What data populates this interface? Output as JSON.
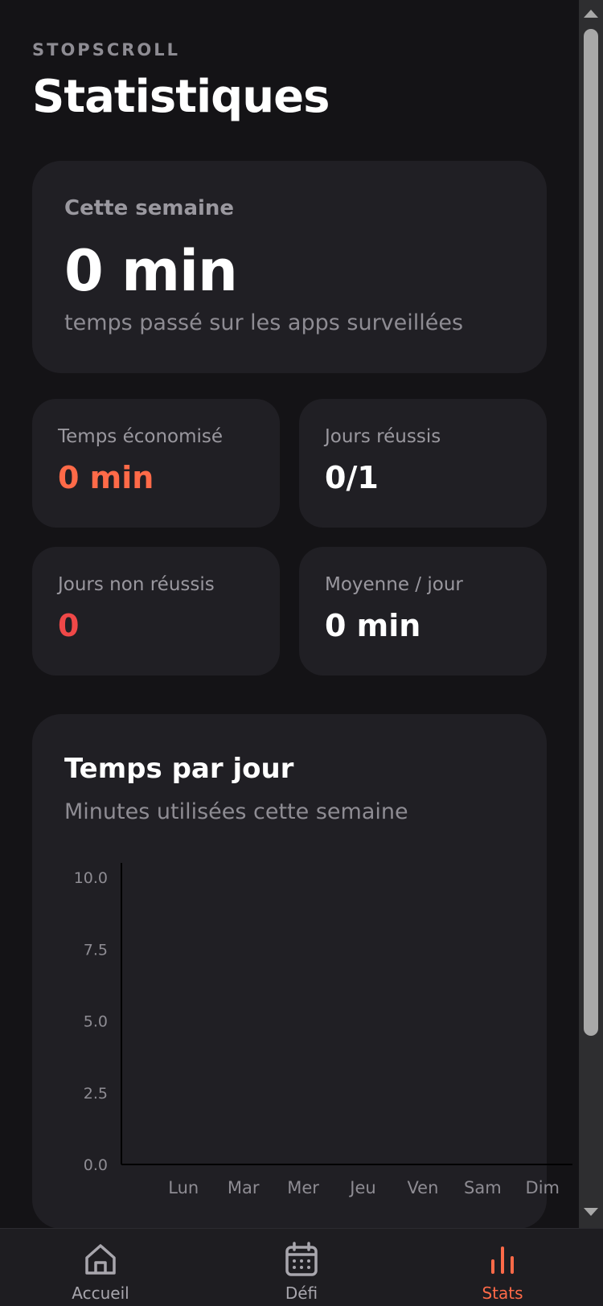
{
  "header": {
    "brand": "STOPSCROLL",
    "title": "Statistiques"
  },
  "week": {
    "label": "Cette semaine",
    "value": "0 min",
    "subtitle": "temps passé sur les apps surveillées"
  },
  "stats": [
    {
      "label": "Temps économisé",
      "value": "0 min",
      "color": "#ff6a48"
    },
    {
      "label": "Jours réussis",
      "value": "0/1",
      "color": "#ffffff"
    },
    {
      "label": "Jours non réussis",
      "value": "0",
      "color": "#f04848"
    },
    {
      "label": "Moyenne / jour",
      "value": "0 min",
      "color": "#ffffff"
    }
  ],
  "chart": {
    "title": "Temps par jour",
    "subtitle": "Minutes utilisées cette semaine"
  },
  "chart_data": {
    "type": "bar",
    "categories": [
      "Lun",
      "Mar",
      "Mer",
      "Jeu",
      "Ven",
      "Sam",
      "Dim"
    ],
    "values": [
      0,
      0,
      0,
      0,
      0,
      0,
      0
    ],
    "ylim": [
      0,
      10
    ],
    "yticks": [
      "10.0",
      "7.5",
      "5.0",
      "2.5",
      "0.0"
    ],
    "ytick_values": [
      10,
      7.5,
      5,
      2.5,
      0
    ],
    "grid": false,
    "bar_color": "#ff6a48"
  },
  "tabs": [
    {
      "label": "Accueil",
      "icon": "home-icon",
      "active": false
    },
    {
      "label": "Défi",
      "icon": "calendar-icon",
      "active": false
    },
    {
      "label": "Stats",
      "icon": "bar-chart-icon",
      "active": true
    }
  ],
  "colors": {
    "accent": "#ff6a48",
    "danger": "#f04848",
    "card": "#201f24",
    "background": "#141316"
  }
}
